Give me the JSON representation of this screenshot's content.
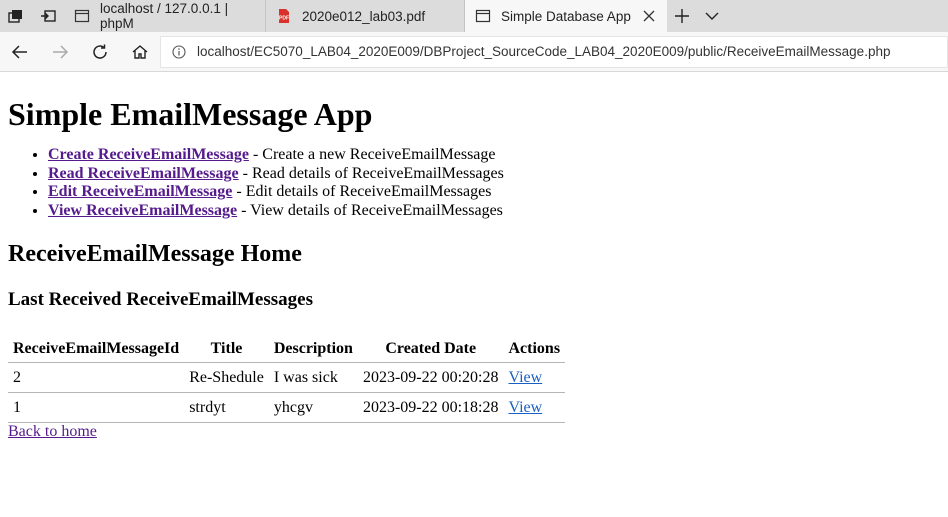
{
  "browser": {
    "tabs": [
      {
        "title": "localhost / 127.0.0.1 | phpM",
        "icon": "window-icon"
      },
      {
        "title": "2020e012_lab03.pdf",
        "icon": "pdf-icon"
      },
      {
        "title": "Simple Database App",
        "icon": "window-icon",
        "active": true
      }
    ],
    "url": "localhost/EC5070_LAB04_2020E009/DBProject_SourceCode_LAB04_2020E009/public/ReceiveEmailMessage.php"
  },
  "page": {
    "title": "Simple EmailMessage App",
    "menu": [
      {
        "link": "Create ReceiveEmailMessage",
        "desc": " - Create a new ReceiveEmailMessage"
      },
      {
        "link": "Read ReceiveEmailMessage",
        "desc": " - Read details of ReceiveEmailMessages"
      },
      {
        "link": "Edit ReceiveEmailMessage",
        "desc": " - Edit details of ReceiveEmailMessages"
      },
      {
        "link": "View ReceiveEmailMessage",
        "desc": " - View details of ReceiveEmailMessages"
      }
    ],
    "section_title": "ReceiveEmailMessage Home",
    "subsection_title": "Last Received ReceiveEmailMessages",
    "table": {
      "headers": [
        "ReceiveEmailMessageId",
        "Title",
        "Description",
        "Created Date",
        "Actions"
      ],
      "rows": [
        {
          "id": "2",
          "title": "Re-Shedule",
          "description": "I was sick",
          "created": "2023-09-22 00:20:28",
          "action": "View"
        },
        {
          "id": "1",
          "title": "strdyt",
          "description": "yhcgv",
          "created": "2023-09-22 00:18:28",
          "action": "View"
        }
      ]
    },
    "back_link": "Back to home"
  }
}
